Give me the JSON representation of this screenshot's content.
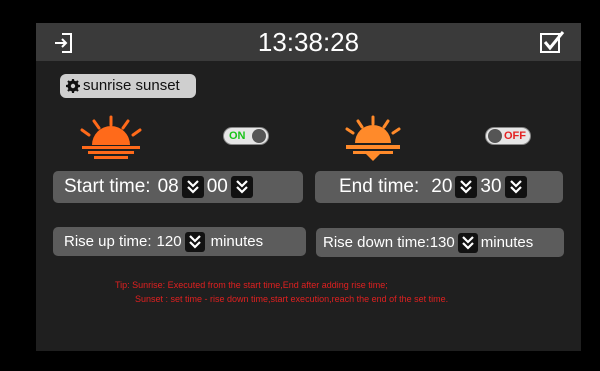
{
  "header": {
    "time": "13:38:28",
    "exit_icon": "exit-icon",
    "confirm_icon": "checkbox-icon"
  },
  "mode": {
    "label": "sunrise sunset",
    "icon": "gear-icon"
  },
  "sunrise": {
    "icon": "sunrise-icon",
    "color": "#ff6a1a",
    "toggle_label": "ON",
    "toggle_state": true
  },
  "sunset": {
    "icon": "sunset-icon",
    "color": "#ff8a2a",
    "toggle_label": "OFF",
    "toggle_state": false
  },
  "start_time": {
    "label": "Start time:",
    "hour": "08",
    "minute": "00"
  },
  "end_time": {
    "label": "End time:",
    "hour": "20",
    "minute": "30"
  },
  "rise_up": {
    "label": "Rise up time:",
    "value": "120",
    "unit": "minutes"
  },
  "rise_down": {
    "label": "Rise down time:",
    "value": "130",
    "unit": "minutes"
  },
  "tips": {
    "line1": "Tip: Sunrise: Executed from the start time,End after adding rise time;",
    "line2": "Sunset : set time - rise down time,start execution,reach the end of the set time."
  },
  "colors": {
    "background": "#1f1f1f",
    "topbar": "#3a3a3a",
    "panel": "#5c5c5c",
    "on_green": "#19c319",
    "off_red": "#e42222",
    "tip_red": "#e02020"
  }
}
